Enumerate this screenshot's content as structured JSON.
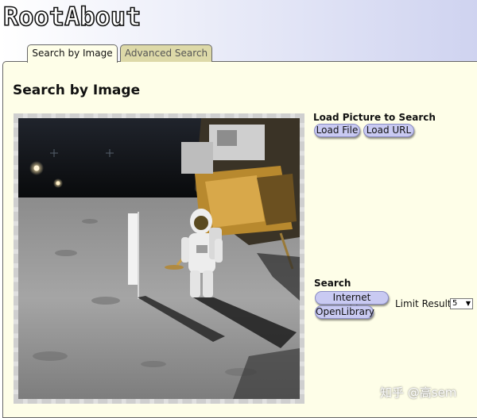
{
  "app": {
    "logo_text": "RootAbout"
  },
  "tabs": [
    {
      "label": "Search by Image",
      "active": true
    },
    {
      "label": "Advanced Search",
      "active": false
    }
  ],
  "page": {
    "title": "Search by Image"
  },
  "load_section": {
    "title": "Load Picture to Search",
    "load_file_label": "Load File",
    "load_url_label": "Load URL"
  },
  "search_section": {
    "title": "Search",
    "internet_archive_label": "Internet Archive",
    "openlibrary_label": "OpenLibrary",
    "limit_label": "Limit Results:",
    "limit_value": "5"
  },
  "watermark": "知乎 @高sem",
  "colors": {
    "panel_bg": "#fefee8",
    "button_bg": "#c9caf2",
    "inactive_tab_bg": "#ddd9a8"
  }
}
